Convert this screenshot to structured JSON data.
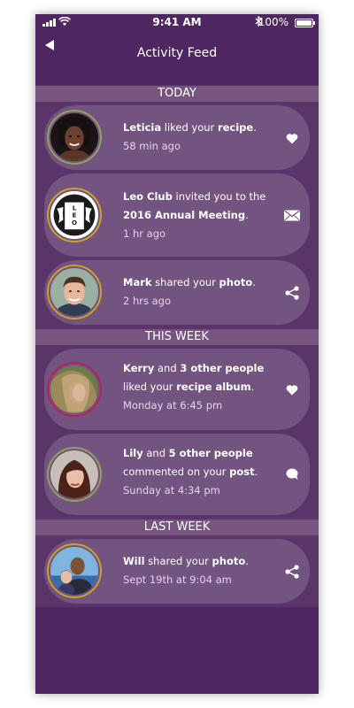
{
  "status_bar": {
    "time": "9:41 AM",
    "battery": "100%",
    "icons": [
      "signal-icon",
      "wifi-icon",
      "bluetooth-icon",
      "battery-icon"
    ]
  },
  "header": {
    "title": "Activity Feed",
    "back_icon": "back-arrow-icon"
  },
  "sections": {
    "today": "TODAY",
    "this_week": "THIS WEEK",
    "last_week": "LAST WEEK"
  },
  "items": [
    {
      "actor": "Leticia",
      "text1": " liked your ",
      "object": "recipe",
      "text2": ".",
      "time": "58 min ago",
      "action_icon": "heart-icon"
    },
    {
      "actor": "Leo Club",
      "text1": " invited you to the ",
      "object": "2016 Annual Meeting",
      "text2": ".",
      "time": "1 hr ago",
      "action_icon": "envelope-icon"
    },
    {
      "actor": "Mark",
      "text1": " shared your ",
      "object": "photo",
      "text2": ".",
      "time": "2 hrs ago",
      "action_icon": "share-icon"
    },
    {
      "actor": "Kerry",
      "joiner": " and ",
      "others": "3 other people",
      "text1": "liked your ",
      "object": "recipe album",
      "text2": ".",
      "time": "Monday at 6:45 pm",
      "action_icon": "heart-icon"
    },
    {
      "actor": "Lily",
      "joiner": " and ",
      "others": "5 other people",
      "text1": "commented on your ",
      "object": "post",
      "text2": ".",
      "time": "Sunday at 4:34 pm",
      "action_icon": "comment-icon"
    },
    {
      "actor": "Will",
      "text1": " shared your ",
      "object": "photo",
      "text2": ".",
      "time": "Sept 19th at 9:04 am",
      "action_icon": "share-icon"
    }
  ],
  "colors": {
    "background": "#4e2761",
    "card": "#735380",
    "section_header": "#76567f",
    "avatar_ring_gold": "#c9a227",
    "avatar_ring_green": "#8fa35a",
    "avatar_ring_red": "#b0245a"
  }
}
